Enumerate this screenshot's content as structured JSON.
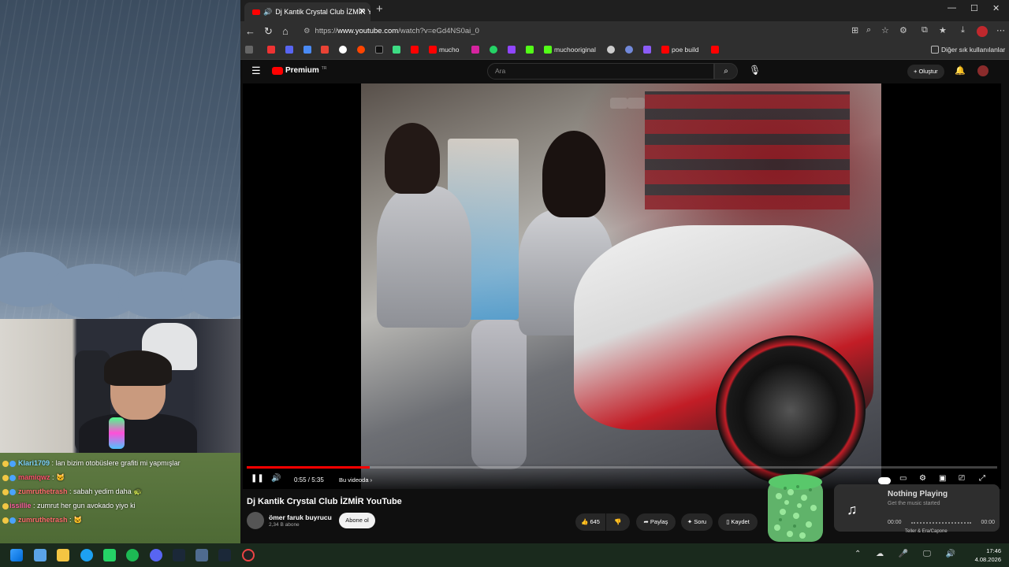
{
  "browser": {
    "tab_title": "Dj Kantik Crystal Club İZMİR Y",
    "url_prefix": "https://",
    "url_host": "www.youtube.com",
    "url_path": "/watch?v=eGd4NS0ai_0",
    "bookmarks": [
      "mucho",
      "muchooriginal",
      "poe build"
    ],
    "other_bookmarks": "Diğer sık kullanılanlar"
  },
  "youtube": {
    "brand": "Premium",
    "brand_sup": "TR",
    "search_placeholder": "Ara",
    "create_label": "Oluştur",
    "player": {
      "time": "0:55 / 5:35",
      "chapter": "Bu videoda",
      "progress": 0.164
    },
    "video_title": "Dj Kantik Crystal Club İZMİR YouTube",
    "channel_name": "ömer faruk buyrucu",
    "subscribers": "2,34 B abone",
    "subscribe_label": "Abone ol",
    "likes": "645",
    "share_label": "Paylaş",
    "ask_label": "Soru",
    "save_label": "Kaydet"
  },
  "stream_overlay": {
    "chat": [
      {
        "user": "Klari1709",
        "message": ": lan bizim otobüslere grafiti mi yapmışlar",
        "color": "#7fd7ff"
      },
      {
        "user": "mamiqwz",
        "message": ":",
        "color": "#ff4f6d"
      },
      {
        "user": "zumruthetrash",
        "message": ": sabah yedim daha",
        "color": "#ff6d6d"
      },
      {
        "user": "issillie",
        "message": ": zumrut her gun avokado yiyo ki",
        "color": "#ff5fa2"
      },
      {
        "user": "zumruthetrash",
        "message": ":",
        "color": "#ff6d6d"
      }
    ]
  },
  "now_playing": {
    "title": "Nothing Playing",
    "subtitle": "Get the music started",
    "elapsed": "00:00",
    "duration": "00:00",
    "caption": "Teller & Era/Capone"
  },
  "taskbar": {
    "time": "17:46",
    "date": "4.08.2026"
  }
}
